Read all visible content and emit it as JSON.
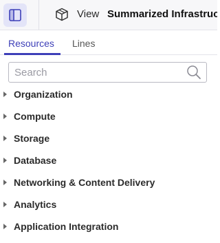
{
  "header": {
    "view_label": "View",
    "view_title": "Summarized Infrastructure",
    "panel_toggle_icon": "sidebar-panel-icon",
    "view_icon": "cube-icon"
  },
  "tabs": [
    {
      "label": "Resources",
      "active": true
    },
    {
      "label": "Lines",
      "active": false
    }
  ],
  "search": {
    "placeholder": "Search",
    "value": "",
    "icon": "search-icon"
  },
  "tree": {
    "items": [
      {
        "label": "Organization"
      },
      {
        "label": "Compute"
      },
      {
        "label": "Storage"
      },
      {
        "label": "Database"
      },
      {
        "label": "Networking & Content Delivery"
      },
      {
        "label": "Analytics"
      },
      {
        "label": "Application Integration"
      }
    ]
  },
  "colors": {
    "accent": "#3d3fb8",
    "toggle_bg": "#e3e4f8"
  }
}
